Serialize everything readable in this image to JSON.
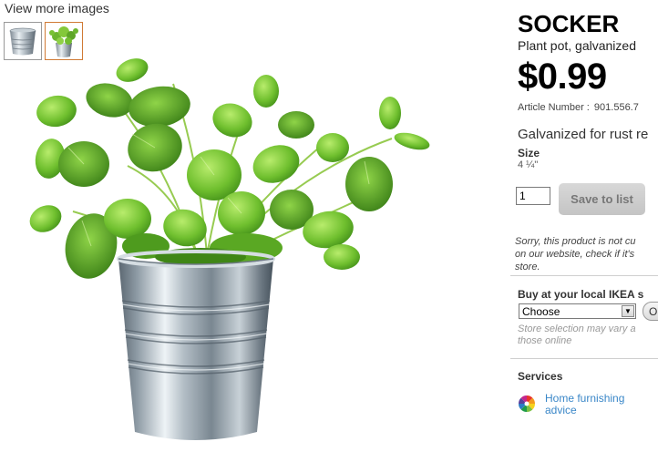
{
  "gallery": {
    "view_more_label": "View more images",
    "thumbnails": [
      {
        "name": "thumbnail-empty-pot",
        "active": false
      },
      {
        "name": "thumbnail-pot-with-plant",
        "active": true
      }
    ]
  },
  "product": {
    "name": "SOCKER",
    "type": "Plant pot, galvanized",
    "price": "$0.99",
    "article_label": "Article Number :",
    "article_number": "901.556.7",
    "description": "Galvanized for rust re",
    "size_label": "Size",
    "size_value": "4 ¼\""
  },
  "purchase": {
    "quantity": "1",
    "save_label": "Save to list",
    "notice_lines": [
      "Sorry, this product is not cu",
      "on our website, check if it's",
      "store."
    ]
  },
  "local_store": {
    "title": "Buy at your local IKEA s",
    "select_value": "Choose",
    "ok_label": "O",
    "note_lines": [
      "Store selection may vary a",
      "those online"
    ]
  },
  "services": {
    "title": "Services",
    "link_lines": [
      "Home furnishing",
      "advice"
    ]
  },
  "colors": {
    "link": "#3a87c8",
    "active_thumb_border": "#d07a35",
    "button_disabled": "#c4c4c4"
  }
}
